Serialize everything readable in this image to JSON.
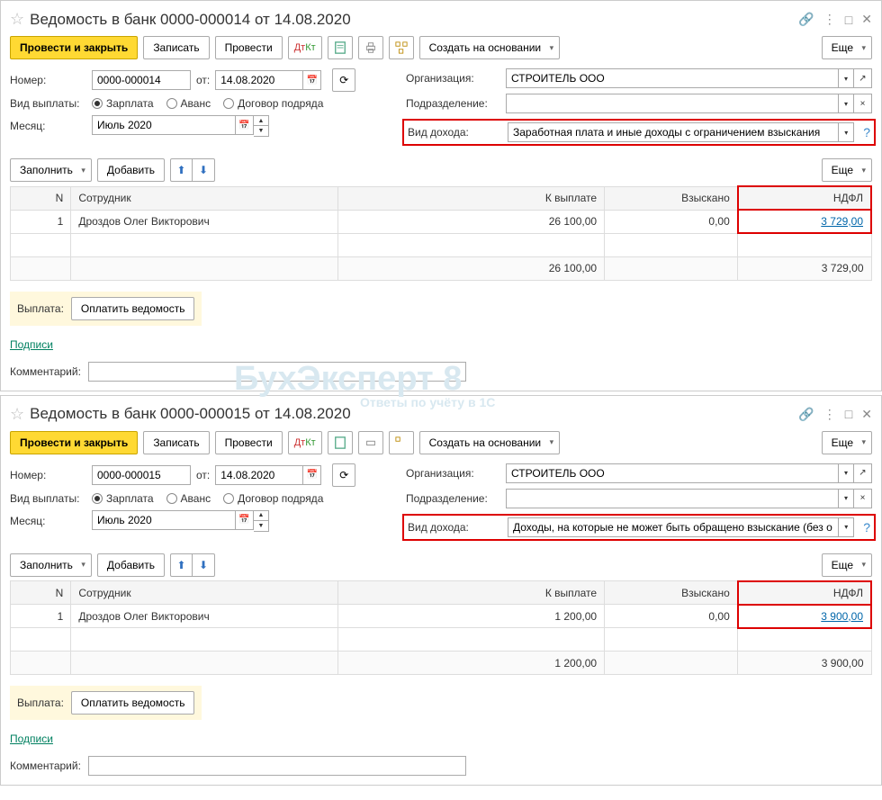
{
  "panels": [
    {
      "title": "Ведомость в банк 0000-000014 от 14.08.2020",
      "toolbar": {
        "post_close": "Провести и закрыть",
        "save": "Записать",
        "post": "Провести",
        "create_based": "Создать на основании",
        "more": "Еще"
      },
      "fields": {
        "number_label": "Номер:",
        "number": "0000-000014",
        "from_label": "от:",
        "date": "14.08.2020",
        "org_label": "Организация:",
        "org": "СТРОИТЕЛЬ ООО",
        "pay_type_label": "Вид выплаты:",
        "radio_salary": "Зарплата",
        "radio_advance": "Аванс",
        "radio_contract": "Договор подряда",
        "dept_label": "Подразделение:",
        "dept": "",
        "month_label": "Месяц:",
        "month": "Июль 2020",
        "income_label": "Вид дохода:",
        "income": "Заработная плата и иные доходы с ограничением взыскания"
      },
      "table_toolbar": {
        "fill": "Заполнить",
        "add": "Добавить",
        "more": "Еще"
      },
      "table": {
        "headers": {
          "n": "N",
          "emp": "Сотрудник",
          "pay": "К выплате",
          "vz": "Взыскано",
          "ndfl": "НДФЛ"
        },
        "rows": [
          {
            "n": "1",
            "emp": "Дроздов Олег Викторович",
            "pay": "26 100,00",
            "vz": "0,00",
            "ndfl": "3 729,00"
          }
        ],
        "total": {
          "pay": "26 100,00",
          "vz": "",
          "ndfl": "3 729,00"
        }
      },
      "payment": {
        "label": "Выплата:",
        "button": "Оплатить ведомость"
      },
      "signatures": "Подписи",
      "comment_label": "Комментарий:",
      "comment": ""
    },
    {
      "title": "Ведомость в банк 0000-000015 от 14.08.2020",
      "toolbar": {
        "post_close": "Провести и закрыть",
        "save": "Записать",
        "post": "Провести",
        "create_based": "Создать на основании",
        "more": "Еще"
      },
      "fields": {
        "number_label": "Номер:",
        "number": "0000-000015",
        "from_label": "от:",
        "date": "14.08.2020",
        "org_label": "Организация:",
        "org": "СТРОИТЕЛЬ ООО",
        "pay_type_label": "Вид выплаты:",
        "radio_salary": "Зарплата",
        "radio_advance": "Аванс",
        "radio_contract": "Договор подряда",
        "dept_label": "Подразделение:",
        "dept": "",
        "month_label": "Месяц:",
        "month": "Июль 2020",
        "income_label": "Вид дохода:",
        "income": "Доходы, на которые не может быть обращено взыскание (без о"
      },
      "table_toolbar": {
        "fill": "Заполнить",
        "add": "Добавить",
        "more": "Еще"
      },
      "table": {
        "headers": {
          "n": "N",
          "emp": "Сотрудник",
          "pay": "К выплате",
          "vz": "Взыскано",
          "ndfl": "НДФЛ"
        },
        "rows": [
          {
            "n": "1",
            "emp": "Дроздов Олег Викторович",
            "pay": "1 200,00",
            "vz": "0,00",
            "ndfl": "3 900,00"
          }
        ],
        "total": {
          "pay": "1 200,00",
          "vz": "",
          "ndfl": "3 900,00"
        }
      },
      "payment": {
        "label": "Выплата:",
        "button": "Оплатить ведомость"
      },
      "signatures": "Подписи",
      "comment_label": "Комментарий:",
      "comment": ""
    }
  ],
  "watermark": {
    "main": "БухЭксперт 8",
    "sub": "Ответы по учёту в 1С"
  }
}
